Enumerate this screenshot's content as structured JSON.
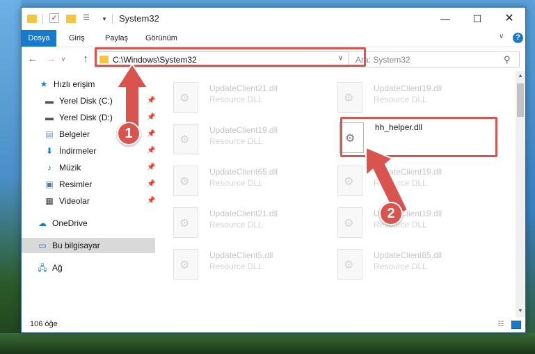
{
  "window": {
    "title": "System32",
    "min_glyph": "—",
    "max_glyph": "☐",
    "close_glyph": "✕"
  },
  "ribbon": {
    "tabs": [
      "Dosya",
      "Giriş",
      "Paylaş",
      "Görünüm"
    ],
    "help": "?"
  },
  "nav": {
    "address": "C:\\Windows\\System32",
    "search_placeholder": "Ara: System32"
  },
  "sidebar": {
    "items": [
      {
        "label": "Hızlı erişim",
        "icon": "star-icon",
        "pinned": false
      },
      {
        "label": "Yerel Disk (C:)",
        "icon": "drive-icon",
        "pinned": true
      },
      {
        "label": "Yerel Disk (D:)",
        "icon": "drive-icon",
        "pinned": true
      },
      {
        "label": "Belgeler",
        "icon": "documents-icon",
        "pinned": true
      },
      {
        "label": "İndirmeler",
        "icon": "download-icon",
        "pinned": true
      },
      {
        "label": "Müzik",
        "icon": "music-icon",
        "pinned": true
      },
      {
        "label": "Resimler",
        "icon": "pictures-icon",
        "pinned": true
      },
      {
        "label": "Videolar",
        "icon": "video-icon",
        "pinned": true
      },
      {
        "label": "OneDrive",
        "icon": "cloud-icon",
        "pinned": false
      },
      {
        "label": "Bu bilgisayar",
        "icon": "computer-icon",
        "pinned": false,
        "selected": true
      },
      {
        "label": "Ağ",
        "icon": "network-icon",
        "pinned": false
      }
    ]
  },
  "files": [
    {
      "name": "UpdateClient21.dll",
      "type": "Resource DLL"
    },
    {
      "name": "UpdateClient19.dll",
      "type": "Resource DLL"
    },
    {
      "name": "UpdateClient19.dll",
      "type": "Resource DLL"
    },
    {
      "name": "hh_helper.dll",
      "type": ""
    },
    {
      "name": "UpdateClient65.dll",
      "type": "Resource DLL"
    },
    {
      "name": "UpdateClient19.dll",
      "type": "Resource DLL"
    },
    {
      "name": "UpdateClient21.dll",
      "type": "Resource DLL"
    },
    {
      "name": "UpdateClient19.dll",
      "type": "Resource DLL"
    },
    {
      "name": "UpdateClient5.dll",
      "type": "Resource DLL"
    },
    {
      "name": "UpdateClient65.dll",
      "type": "Resource DLL"
    }
  ],
  "status": {
    "item_count": "106 öğe"
  },
  "annotations": {
    "step1": "1",
    "step2": "2",
    "color": "#d9534f"
  }
}
